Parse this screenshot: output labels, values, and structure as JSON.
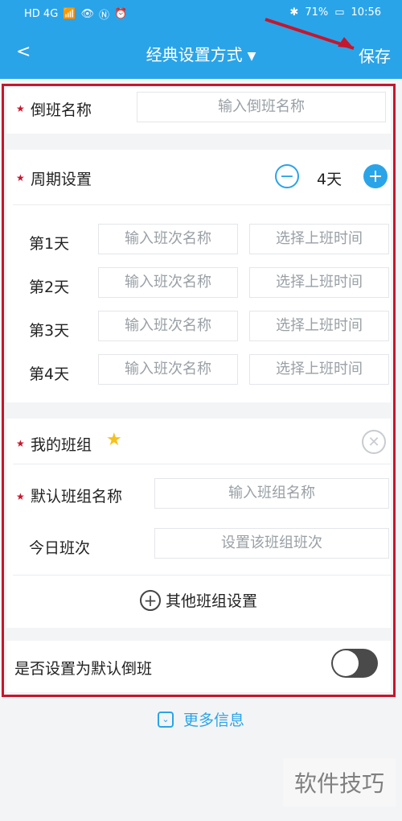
{
  "status_bar": {
    "signal": "HD 4G",
    "battery": "71%",
    "time": "10:56"
  },
  "nav": {
    "back_icon": "chevron-left-icon",
    "title": "经典设置方式",
    "title_caret": "▼",
    "save": "保存"
  },
  "form": {
    "shift_name": {
      "label": "倒班名称",
      "placeholder": "输入倒班名称"
    },
    "cycle": {
      "label": "周期设置",
      "value": "4天"
    },
    "days": [
      {
        "label": "第1天",
        "shift_placeholder": "输入班次名称",
        "time_placeholder": "选择上班时间"
      },
      {
        "label": "第2天",
        "shift_placeholder": "输入班次名称",
        "time_placeholder": "选择上班时间"
      },
      {
        "label": "第3天",
        "shift_placeholder": "输入班次名称",
        "time_placeholder": "选择上班时间"
      },
      {
        "label": "第4天",
        "shift_placeholder": "输入班次名称",
        "time_placeholder": "选择上班时间"
      }
    ],
    "my_group": {
      "label": "我的班组",
      "default_group_label": "默认班组名称",
      "default_group_placeholder": "输入班组名称",
      "today_shift_label": "今日班次",
      "today_shift_placeholder": "设置该班组班次",
      "other_groups": "其他班组设置"
    },
    "set_default": {
      "label": "是否设置为默认倒班",
      "enabled": false
    }
  },
  "more_info": "更多信息",
  "watermark": "软件技巧",
  "colors": {
    "primary": "#2aa4e8",
    "accent_red": "#c6162c"
  }
}
